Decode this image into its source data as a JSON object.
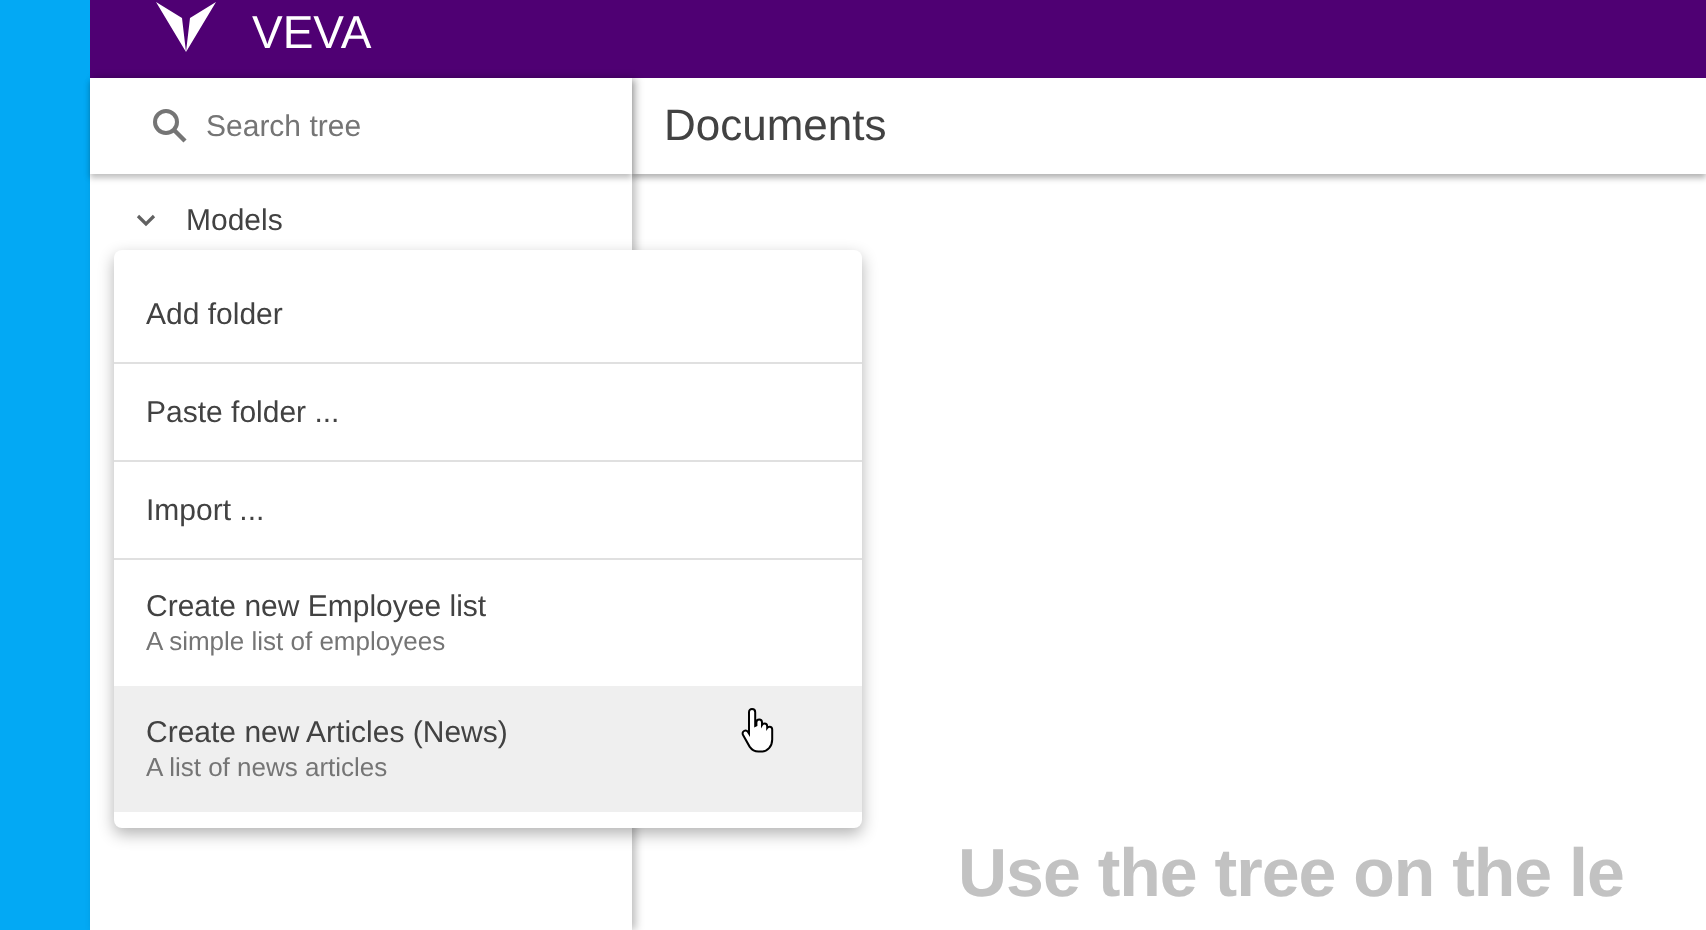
{
  "app": {
    "title": "VEVA"
  },
  "sidebar": {
    "search": {
      "placeholder": "Search tree"
    },
    "tree": [
      {
        "label": "Models",
        "expanded": true
      }
    ]
  },
  "main": {
    "title": "Documents",
    "hint": "Use the tree on the le"
  },
  "context_menu": {
    "items": [
      {
        "label": "Add folder",
        "selected": false
      },
      {
        "label": "Paste folder ...",
        "selected": false
      },
      {
        "label": "Import ...",
        "selected": false
      },
      {
        "label": "Create new Employee list",
        "subtitle": "A simple list of employees",
        "selected": false
      },
      {
        "label": "Create new Articles (News)",
        "subtitle": "A list of news articles",
        "selected": true
      }
    ]
  }
}
